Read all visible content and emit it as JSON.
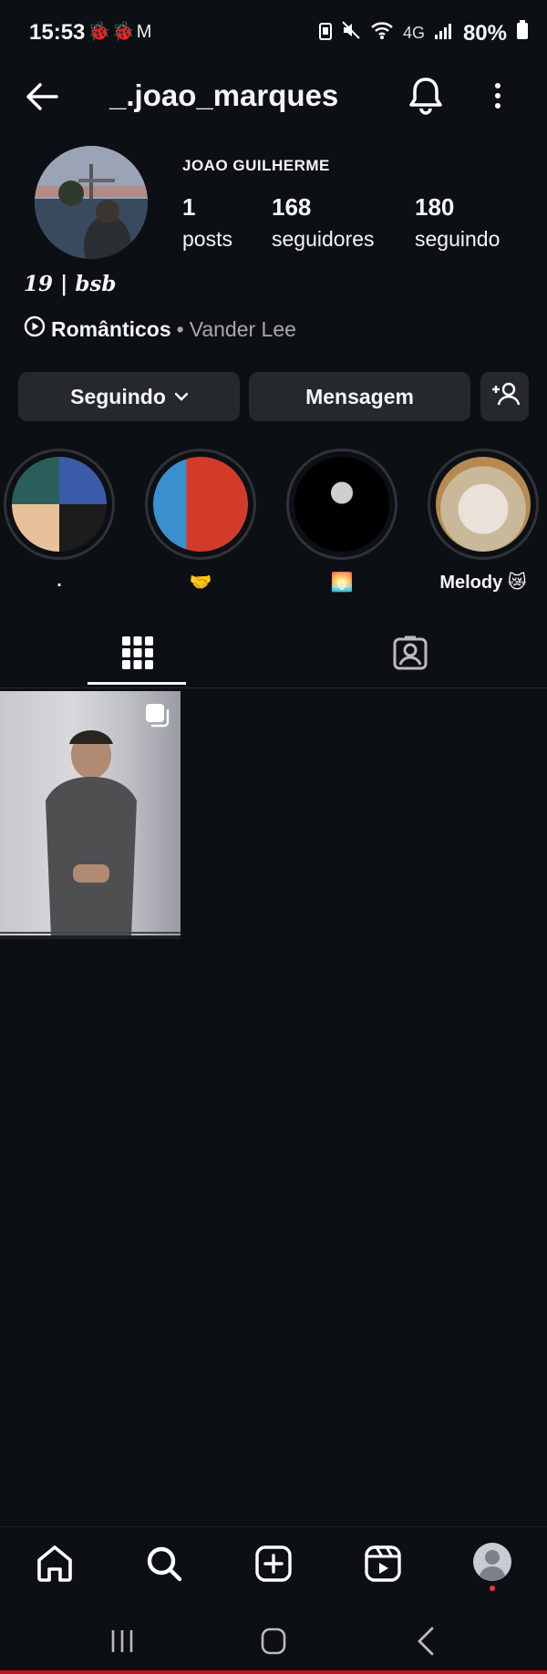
{
  "status_bar": {
    "time": "15:53",
    "notification_icons": "🐞🐞M",
    "signal_text": "4G",
    "battery": "80%"
  },
  "header": {
    "username": "_.joao_marques"
  },
  "profile": {
    "display_name": "JOAO GUILHERME",
    "stats": [
      {
        "value": "1",
        "label": "posts"
      },
      {
        "value": "168",
        "label": "seguidores"
      },
      {
        "value": "180",
        "label": "seguindo"
      }
    ],
    "bio": "19 | bsb",
    "music": {
      "song": "Românticos",
      "separator": " • ",
      "artist": "Vander Lee"
    }
  },
  "actions": {
    "following_label": "Seguindo",
    "message_label": "Mensagem"
  },
  "highlights": [
    {
      "caption": "."
    },
    {
      "caption": "🤝"
    },
    {
      "caption": "🌅"
    },
    {
      "caption": "Melody 😿"
    }
  ],
  "tabs": [
    "grid-icon",
    "tagged-icon"
  ],
  "posts": [
    {
      "type": "carousel",
      "icon": "multiple-posts-icon"
    }
  ],
  "bottom_nav": [
    "home-icon",
    "search-icon",
    "create-icon",
    "reels-icon",
    "profile-icon"
  ],
  "colors": {
    "background": "#0c1014",
    "button": "#25292e",
    "text": "#f5f5f5",
    "muted": "#a8a8a8",
    "notification_dot": "#ff3040"
  }
}
